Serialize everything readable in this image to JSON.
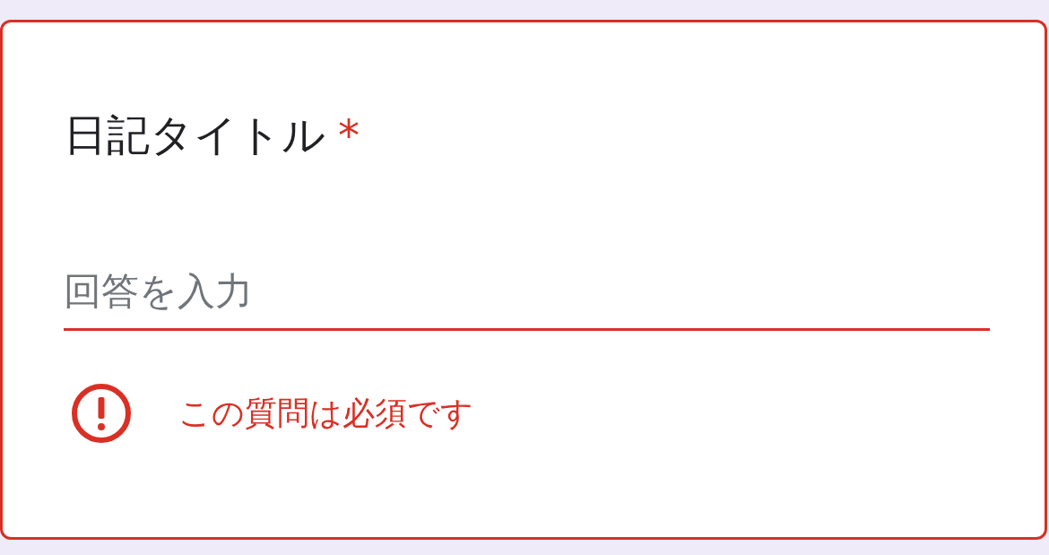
{
  "question": {
    "title": "日記タイトル",
    "required_mark": "*"
  },
  "answer": {
    "placeholder": "回答を入力"
  },
  "error": {
    "message": "この質問は必須です"
  }
}
